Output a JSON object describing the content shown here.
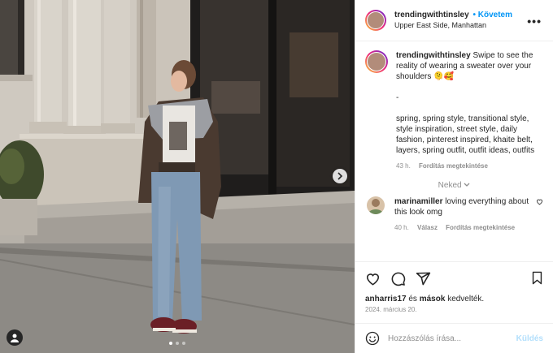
{
  "post": {
    "username": "trendingwithtinsley",
    "follow_label": "Követem",
    "location": "Upper East Side, Manhattan",
    "more_label": "•••"
  },
  "caption": {
    "username": "trendingwithtinsley",
    "text": "Swipe to see the reality of wearing a sweater over your shoulders 🫠🥰\n\n-\n\nspring, spring style, transitional style, style inspiration, street style, daily fashion, pinterest inspired, khaite belt, layers, spring outfit, outfit ideas, outfits",
    "time": "43 h.",
    "translate_label": "Fordítás megtekintése"
  },
  "hidden_comments_label": "Neked",
  "comments": [
    {
      "username": "marinamiller",
      "text": "loving everything about this look omg",
      "time": "40 h.",
      "reply_label": "Válasz",
      "translate_label": "Fordítás megtekintése"
    }
  ],
  "likes": {
    "user": "anharris17",
    "conj": "és",
    "others": "mások",
    "suffix": "kedvelték."
  },
  "date": "2024. március 20.",
  "add_comment": {
    "placeholder": "Hozzászólás írása...",
    "send_label": "Küldés"
  },
  "carousel": {
    "slides": 3,
    "active": 1
  },
  "colors": {
    "accent": "#0095f6",
    "send_disabled": "#b2dffc",
    "muted": "#8e8e8e"
  },
  "icons": [
    "heart-icon",
    "comment-icon",
    "share-icon",
    "bookmark-icon",
    "emoji-icon",
    "chevron-right-icon",
    "user-tag-icon"
  ]
}
